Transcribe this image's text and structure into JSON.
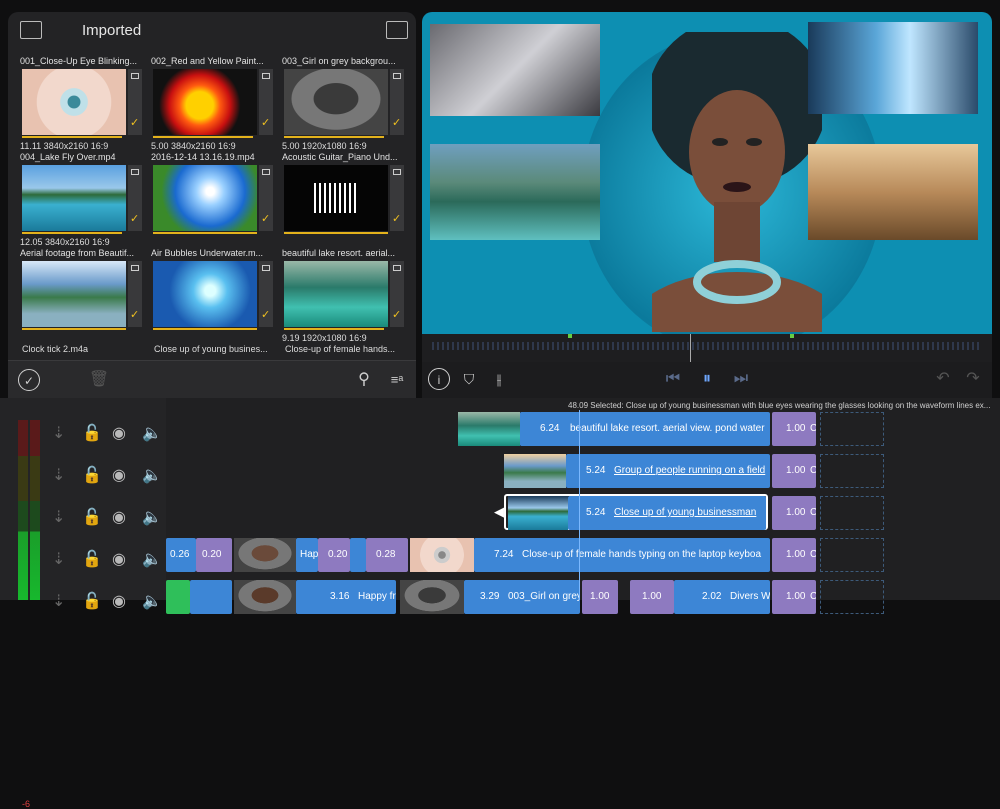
{
  "browser": {
    "title": "Imported",
    "clips": [
      {
        "name": "001_Close-Up Eye Blinking...",
        "meta": "11.11  3840x2160  16:9",
        "kind": "eye"
      },
      {
        "name": "002_Red and Yellow Paint...",
        "meta": "5.00  3840x2160  16:9",
        "kind": "paint"
      },
      {
        "name": "003_Girl on grey backgrou...",
        "meta": "5.00  1920x1080  16:9",
        "kind": "girl"
      },
      {
        "name": "004_Lake Fly Over.mp4",
        "meta": "12.05  3840x2160  16:9",
        "kind": "lake"
      },
      {
        "name": "2016-12-14 13.16.19.mp4",
        "meta": "",
        "kind": "sky"
      },
      {
        "name": "Acoustic Guitar_Piano Und...",
        "meta": "",
        "kind": "audio"
      },
      {
        "name": "Aerial footage from Beautif...",
        "meta": "",
        "kind": "aerial"
      },
      {
        "name": "Air Bubbles Underwater.m...",
        "meta": "",
        "kind": "bubbles"
      },
      {
        "name": "beautiful lake resort. aerial...",
        "meta": "9.19  1920x1080  16:9",
        "kind": "resort"
      }
    ],
    "more_row": [
      "Clock tick 2.m4a",
      "Close up of young busines...",
      "Close-up of female hands..."
    ]
  },
  "timeline": {
    "meter_label": "-6",
    "status": "48.09 Selected: Close up of young businessman with blue eyes wearing the glasses looking on the waveform lines ex...",
    "track1": {
      "dur": "6.24",
      "label": "beautiful lake resort. aerial view. pond water",
      "tail": "1.00",
      "c": "C"
    },
    "track2": {
      "dur": "5.24",
      "label": "Group of people running on a field",
      "tail": "1.00",
      "c": "C"
    },
    "track3": {
      "dur": "5.24",
      "label": "Close up of young businessman",
      "tail": "1.00",
      "c": "C"
    },
    "track4": {
      "a": "0.26",
      "b": "Hap",
      "c": "0.20",
      "d": "0.28",
      "dur": "7.24",
      "label": "Close-up of female hands typing on the laptop keyboa",
      "tail": "1.00",
      "cc": "C"
    },
    "track5": {
      "a": "3.16",
      "a_label": "Happy fr",
      "dur": "3.29",
      "label": "003_Girl on grey",
      "t1": "1.00",
      "t2": "1.00",
      "t3": "2.02",
      "t3label": "Divers W",
      "t4": "1.00",
      "c": "C"
    }
  },
  "colors": {
    "accent": "#e3b21c",
    "clip_blue": "#3d86d6",
    "clip_purple": "#8e7ac0",
    "viewer_bg": "#0d8fb2"
  }
}
